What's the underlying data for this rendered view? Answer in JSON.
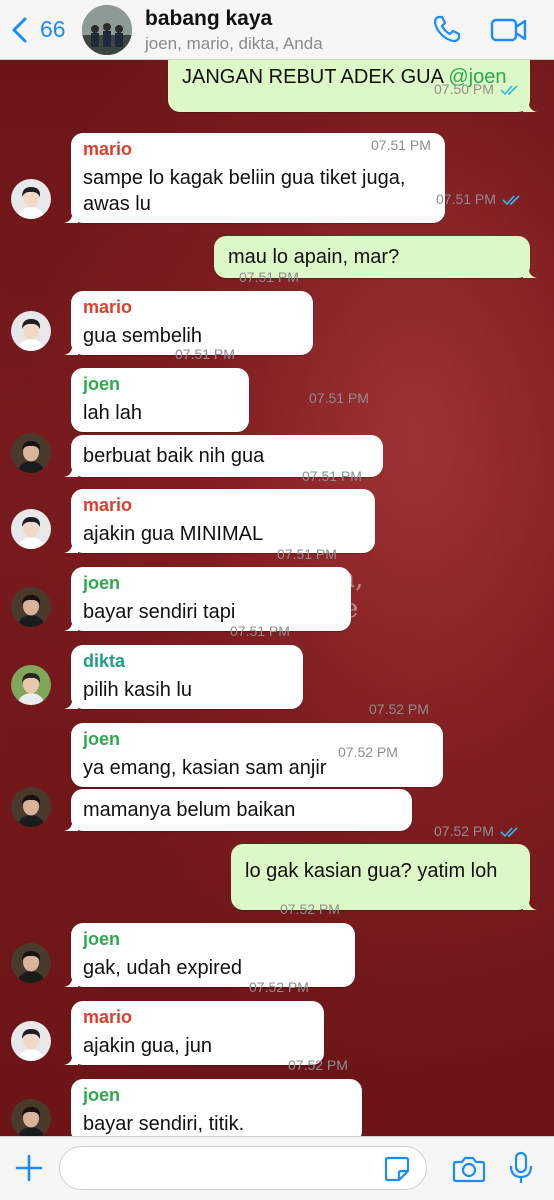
{
  "header": {
    "back_count": "66",
    "group_name": "babang kaya",
    "members": "joen, mario, dikta, Anda"
  },
  "colors": {
    "mario": "#d9412e",
    "joen": "#2fa84f",
    "dikta": "#1f9e8a",
    "tick": "#34b7f1",
    "accent": "#1a8cff"
  },
  "messages": [
    {
      "dir": "out",
      "text": [
        "JANGAN REBUT ADEK GUA "
      ],
      "mention": "@joen",
      "time": "07.50 PM",
      "read": true
    },
    {
      "dir": "in",
      "sender": "mario",
      "text": [
        "sampe lo kagak beliin gua tiket juga,",
        "awas lu"
      ],
      "time": "07.51 PM"
    },
    {
      "dir": "out",
      "text": [
        "mau lo apain, mar?"
      ],
      "time": "07.51 PM",
      "read": true
    },
    {
      "dir": "in",
      "sender": "mario",
      "text": [
        "gua sembelih"
      ],
      "time": "07.51 PM"
    },
    {
      "dir": "in",
      "sender": "joen",
      "text": [
        "lah lah"
      ],
      "time": "07.51 PM"
    },
    {
      "dir": "in",
      "text": [
        "berbuat baik nih gua"
      ],
      "time": "07.51 PM"
    },
    {
      "dir": "in",
      "sender": "mario",
      "text": [
        "ajakin gua MINIMAL"
      ],
      "time": "07.51 PM"
    },
    {
      "dir": "in",
      "sender": "joen",
      "text": [
        "bayar sendiri tapi"
      ],
      "time": "07.51 PM"
    },
    {
      "dir": "in",
      "sender": "dikta",
      "text": [
        "pilih kasih lu"
      ],
      "time": "07.51 PM"
    },
    {
      "dir": "in",
      "sender": "joen",
      "text": [
        "ya emang, kasian sam anjir"
      ],
      "time": "07.52 PM"
    },
    {
      "dir": "in",
      "text": [
        "mamanya belum baikan"
      ],
      "time": "07.52 PM"
    },
    {
      "dir": "out",
      "text": [
        "lo gak kasian gua? yatim loh"
      ],
      "time": "07.52 PM",
      "read": true
    },
    {
      "dir": "in",
      "sender": "joen",
      "text": [
        "gak, udah expired"
      ],
      "time": "07.52 PM"
    },
    {
      "dir": "in",
      "sender": "mario",
      "text": [
        "ajakin gua, jun"
      ],
      "time": "07.52 PM"
    },
    {
      "dir": "in",
      "sender": "joen",
      "text": [
        "bayar sendiri, titik."
      ],
      "time": "07.52 PM"
    }
  ],
  "background_text": [
    "en,",
    "e"
  ],
  "composer": {
    "placeholder": ""
  },
  "icons": {
    "back": "chevron-left-icon",
    "call": "phone-icon",
    "video": "video-camera-icon",
    "plus": "plus-icon",
    "sticker": "sticker-icon",
    "camera": "camera-icon",
    "mic": "microphone-icon"
  }
}
